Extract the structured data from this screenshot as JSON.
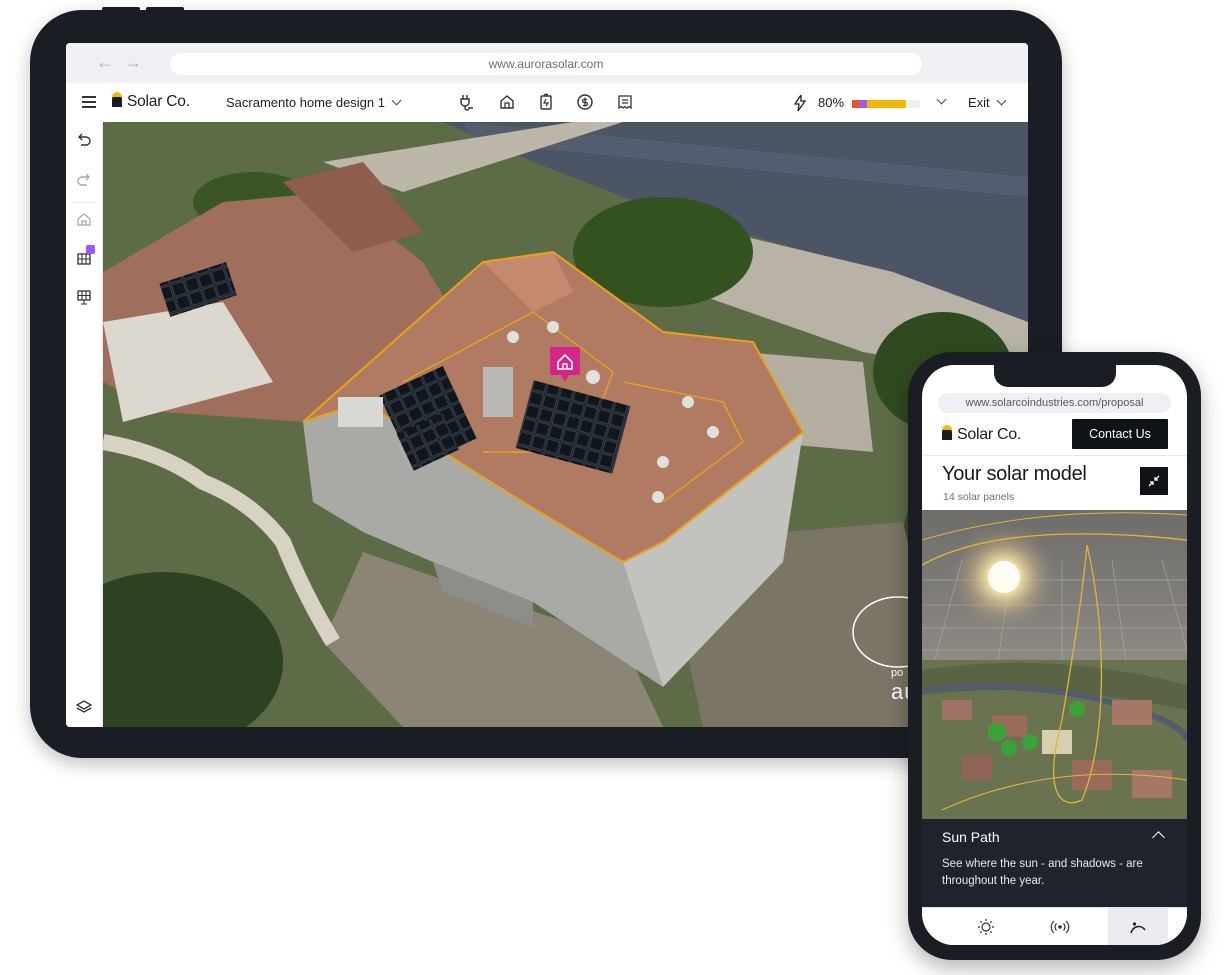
{
  "tablet": {
    "browser": {
      "url": "www.aurorasolar.com",
      "back_icon": "arrow-left-icon",
      "forward_icon": "arrow-right-icon"
    },
    "toolbar": {
      "menu_icon": "hamburger-icon",
      "brand": "Solar Co.",
      "design_name": "Sacramento home design 1",
      "tools": [
        "plug-icon",
        "home-icon",
        "battery-icon",
        "dollar-icon",
        "receipt-icon"
      ],
      "battery_percent": "80%",
      "battery_level": 0.8,
      "battery_colors": [
        "#e4572e",
        "#9b59f5",
        "#f2b705"
      ],
      "exit_label": "Exit"
    },
    "sidebar": [
      "undo-icon",
      "redo-icon",
      "roof-edit-icon",
      "panel-grid-icon",
      "panel-array-icon",
      "layers-icon"
    ],
    "map": {
      "powered_by": "po",
      "logo": "au"
    }
  },
  "phone": {
    "url": "www.solarcoindustries.com/proposal",
    "brand": "Solar Co.",
    "contact_label": "Contact Us",
    "title": "Your solar model",
    "subtitle": "14 solar panels",
    "sun_path": {
      "title": "Sun Path",
      "description": "See where the sun - and shadows - are throughout the year."
    },
    "tabs": [
      "sun-icon",
      "broadcast-icon",
      "sun-arc-icon"
    ],
    "active_tab": 2
  },
  "colors": {
    "brand_yellow": "#f2b705",
    "dark": "#1a1d24",
    "pin_magenta": "#d6248a",
    "roof_outline": "#e8a317"
  }
}
